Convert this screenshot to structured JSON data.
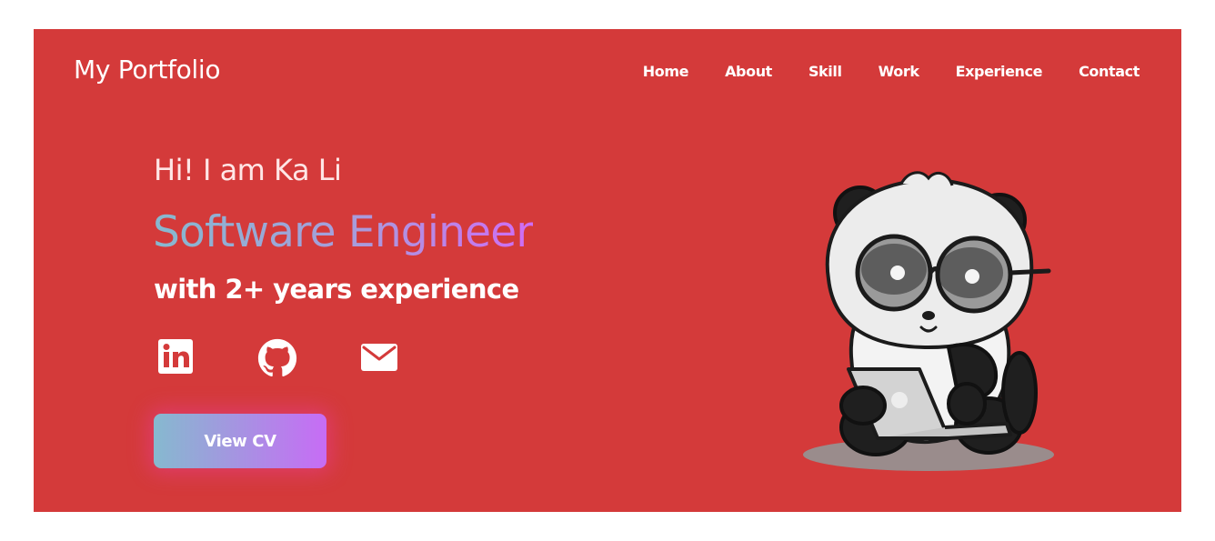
{
  "brand": {
    "title": "My Portfolio"
  },
  "nav": {
    "items": [
      {
        "label": "Home"
      },
      {
        "label": "About"
      },
      {
        "label": "Skill"
      },
      {
        "label": "Work"
      },
      {
        "label": "Experience"
      },
      {
        "label": "Contact"
      }
    ]
  },
  "hero": {
    "greeting": "Hi! I am Ka Li",
    "role": "Software Engineer",
    "tagline": "with 2+ years experience",
    "cv_button": "View CV"
  },
  "social": [
    {
      "icon": "linkedin-icon"
    },
    {
      "icon": "github-icon"
    },
    {
      "icon": "mail-icon"
    }
  ],
  "colors": {
    "hero_background": "#d43a3a",
    "accent_gradient_start": "#86b9cf",
    "accent_gradient_end": "#cf6cf5",
    "text": "#ffffff"
  },
  "illustration": {
    "icon": "panda-with-laptop-illustration"
  }
}
